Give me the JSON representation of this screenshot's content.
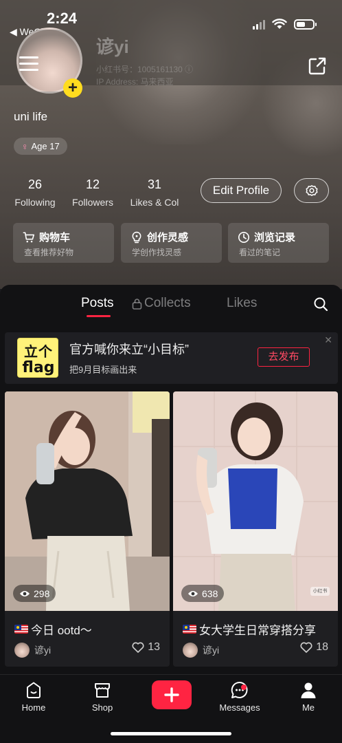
{
  "status_bar": {
    "time": "2:24",
    "back_label": "◀ WeChat"
  },
  "profile": {
    "username": "谚yi",
    "uid_line": "小红书号：1005161130  ⓘ",
    "ip_line": "IP Address: 马来西亚",
    "bio": "uni life",
    "age_tag": "Age 17",
    "edit_profile": "Edit Profile"
  },
  "stats": [
    {
      "value": "26",
      "label": "Following"
    },
    {
      "value": "12",
      "label": "Followers"
    },
    {
      "value": "31",
      "label": "Likes & Col"
    }
  ],
  "quick_links": [
    {
      "title": "购物车",
      "subtitle": "查看推荐好物",
      "icon": "cart-icon"
    },
    {
      "title": "创作灵感",
      "subtitle": "学创作找灵感",
      "icon": "bulb-icon"
    },
    {
      "title": "浏览记录",
      "subtitle": "看过的笔记",
      "icon": "clock-icon"
    }
  ],
  "tabs": {
    "posts": "Posts",
    "collects": "Collects",
    "likes": "Likes"
  },
  "banner": {
    "logo_line1": "立个",
    "logo_line2": "flag",
    "title": "官方喊你来立“小目标”",
    "subtitle": "把9月目标画出来",
    "button": "去发布",
    "close": "✕"
  },
  "posts": [
    {
      "views": "298",
      "title": "今日 ootd～",
      "author": "谚yi",
      "likes": "13"
    },
    {
      "views": "638",
      "title": "女大学生日常穿搭分享",
      "author": "谚yi",
      "likes": "18",
      "watermark": "小红书"
    }
  ],
  "bottom_nav": {
    "home": "Home",
    "shop": "Shop",
    "messages": "Messages",
    "me": "Me"
  },
  "colors": {
    "accent": "#ff2442",
    "age_female": "#ff8fb4",
    "flag_yellow": "#fff27a"
  }
}
